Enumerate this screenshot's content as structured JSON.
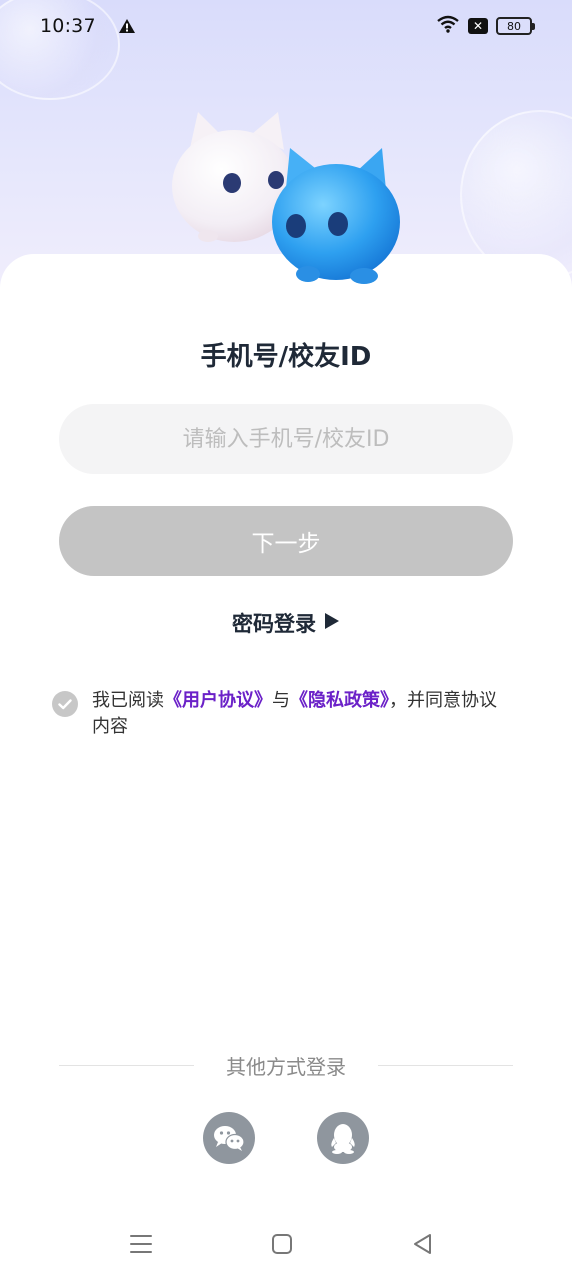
{
  "status_bar": {
    "time": "10:37",
    "battery": "80",
    "icons": [
      "warning-icon",
      "wifi-icon",
      "sim-blocked-icon",
      "battery-icon"
    ]
  },
  "login": {
    "title": "手机号/校友ID",
    "input_placeholder": "请输入手机号/校友ID",
    "input_value": "",
    "next_button": "下一步",
    "password_login": "密码登录",
    "password_login_arrow": "▶"
  },
  "agreement": {
    "checked": true,
    "prefix": "我已阅读",
    "user_agreement": "《用户协议》",
    "conjunction": "与",
    "privacy_policy": "《隐私政策》",
    "suffix": "，并同意协议内容"
  },
  "other_login": {
    "label": "其他方式登录",
    "options": [
      "wechat-icon",
      "qq-icon"
    ]
  },
  "colors": {
    "link": "#6b21c8",
    "button_disabled": "#c4c4c4",
    "social_icon_bg": "#8f969e"
  },
  "nav": {
    "items": [
      "menu-icon",
      "home-icon",
      "back-icon"
    ]
  }
}
